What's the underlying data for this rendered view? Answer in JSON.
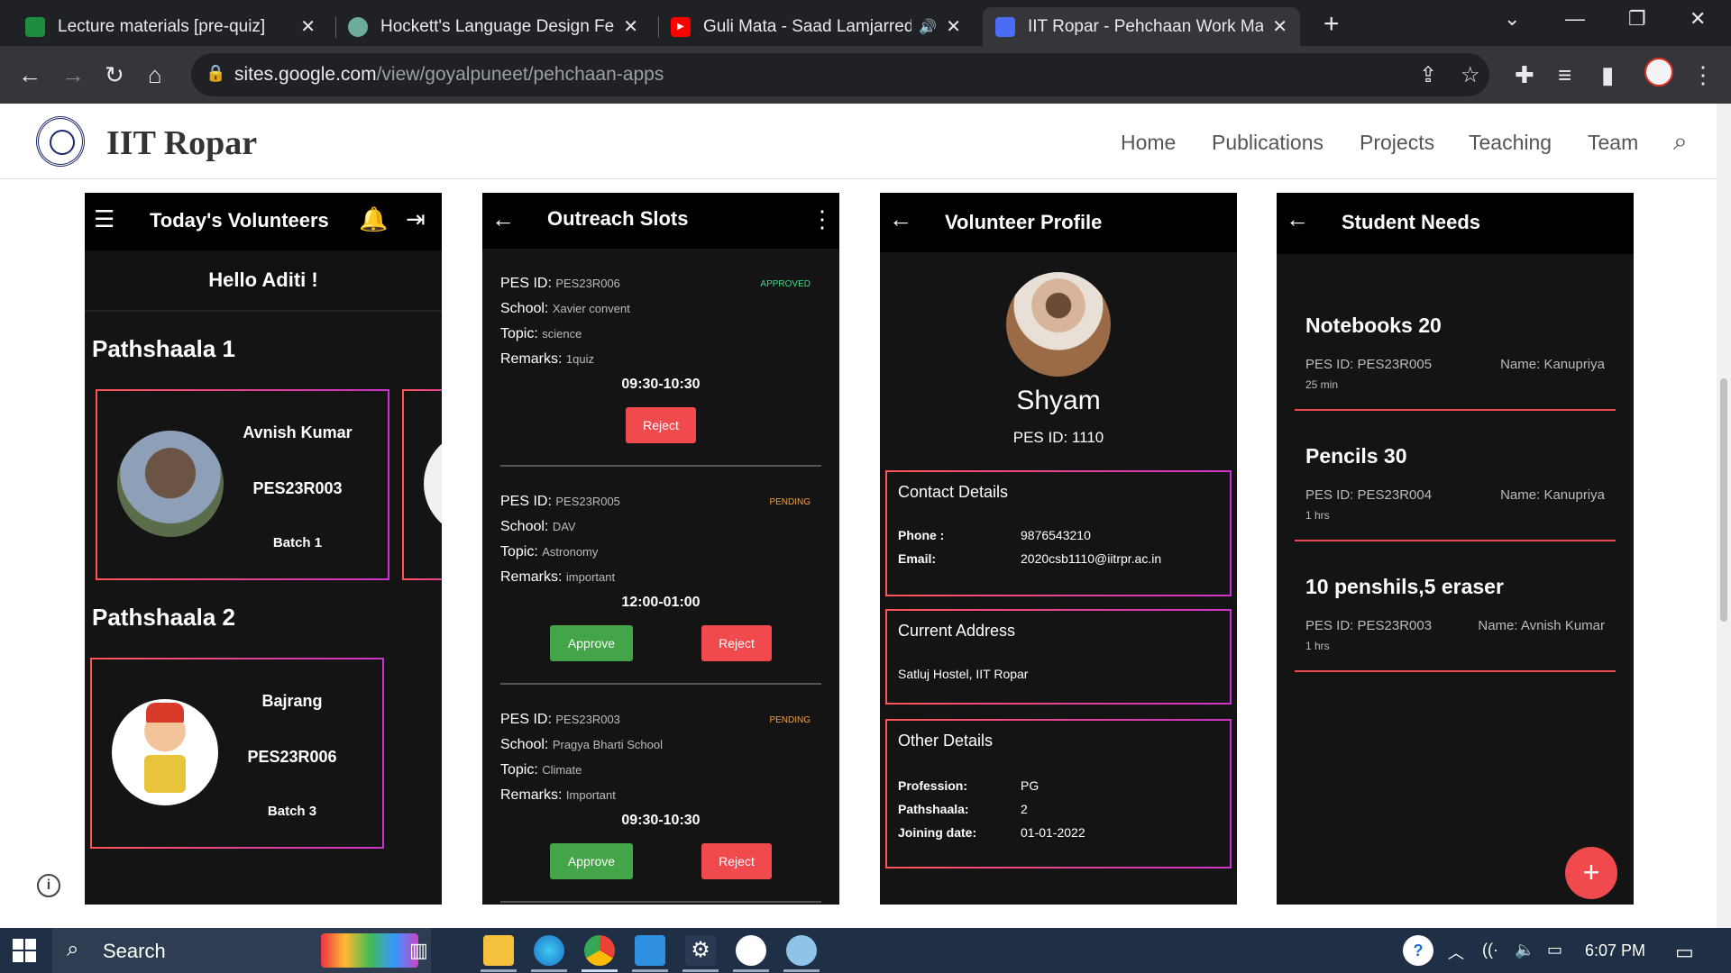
{
  "browser": {
    "tabs": [
      {
        "title": "Lecture materials [pre-quiz]",
        "icon": "google-classroom-icon"
      },
      {
        "title": "Hockett's Language Design Featu",
        "icon": "chatgpt-icon"
      },
      {
        "title": "Guli Mata - Saad Lamjarred |",
        "icon": "youtube-icon"
      },
      {
        "title": "IIT Ropar - Pehchaan Work Mana",
        "icon": "google-sites-icon"
      }
    ],
    "url_host": "sites.google.com",
    "url_path": "/view/goyalpuneet/pehchaan-apps"
  },
  "site": {
    "title": "IIT Ropar",
    "nav": [
      "Home",
      "Publications",
      "Projects",
      "Teaching",
      "Team"
    ]
  },
  "screen1": {
    "title": "Today's Volunteers",
    "greeting": "Hello Aditi !",
    "sections": [
      {
        "heading": "Pathshaala 1",
        "volunteer": {
          "name": "Avnish Kumar",
          "pes_id": "PES23R003",
          "batch": "Batch 1"
        }
      },
      {
        "heading": "Pathshaala 2",
        "volunteer": {
          "name": "Bajrang",
          "pes_id": "PES23R006",
          "batch": "Batch 3"
        }
      }
    ]
  },
  "screen2": {
    "title": "Outreach Slots",
    "labels": {
      "pes": "PES ID:",
      "school": "School:",
      "topic": "Topic:",
      "remarks": "Remarks:",
      "approve": "Approve",
      "reject": "Reject"
    },
    "slots": [
      {
        "pes_id": "PES23R006",
        "school": "Xavier convent",
        "topic": "science",
        "remarks": "1quiz",
        "time": "09:30-10:30",
        "status": "APPROVED",
        "status_color": "#3ddc84"
      },
      {
        "pes_id": "PES23R005",
        "school": "DAV",
        "topic": "Astronomy",
        "remarks": "important",
        "time": "12:00-01:00",
        "status": "PENDING",
        "status_color": "#f5a13c"
      },
      {
        "pes_id": "PES23R003",
        "school": "Pragya Bharti School",
        "topic": "Climate",
        "remarks": "Important",
        "time": "09:30-10:30",
        "status": "PENDING",
        "status_color": "#f5a13c"
      }
    ]
  },
  "screen3": {
    "title": "Volunteer Profile",
    "name": "Shyam",
    "pes_id": "PES ID: 1110",
    "contact": {
      "heading": "Contact Details",
      "phone_label": "Phone :",
      "phone": "9876543210",
      "email_label": "Email:",
      "email": "2020csb1110@iitrpr.ac.in"
    },
    "address": {
      "heading": "Current Address",
      "value": "Satluj Hostel, IIT Ropar"
    },
    "other": {
      "heading": "Other Details",
      "profession_label": "Profession:",
      "profession": "PG",
      "pathshaala_label": "Pathshaala:",
      "pathshaala": "2",
      "joining_label": "Joining date:",
      "joining": "01-01-2022"
    }
  },
  "screen4": {
    "title": "Student Needs",
    "needs": [
      {
        "item": "Notebooks 20",
        "pes_id": "PES ID: PES23R005",
        "name": "Name: Kanupriya",
        "time": "25 min"
      },
      {
        "item": "Pencils 30",
        "pes_id": "PES ID: PES23R004",
        "name": "Name: Kanupriya",
        "time": "1 hrs"
      },
      {
        "item": "10 penshils,5 eraser",
        "pes_id": "PES ID: PES23R003",
        "name": "Name: Avnish Kumar",
        "time": "1 hrs"
      }
    ]
  },
  "taskbar": {
    "search": "Search",
    "clock": "6:07 PM"
  },
  "colors": {
    "accent_red": "#f04a4f",
    "accent_green": "#43a547",
    "card_border_pink": "#cc33cc"
  }
}
